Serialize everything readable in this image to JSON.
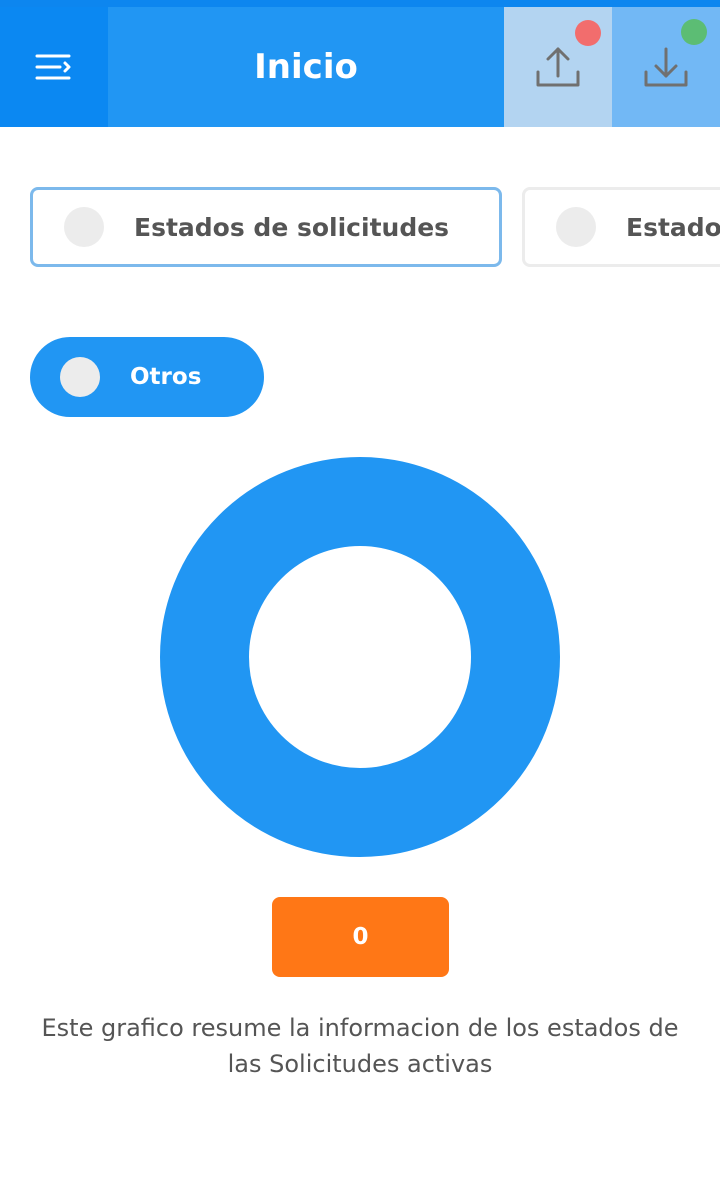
{
  "header": {
    "title": "Inicio",
    "menu_icon": "menu-icon",
    "upload_icon": "upload-icon",
    "download_icon": "download-icon",
    "upload_status_color": "#f26d6d",
    "download_status_color": "#5cbd74"
  },
  "tabs": [
    {
      "label": "Estados de solicitudes",
      "selected": true
    },
    {
      "label": "Estado",
      "selected": false
    }
  ],
  "filter": {
    "label": "Otros",
    "active": true
  },
  "chart_data": {
    "type": "pie",
    "variant": "donut",
    "slices": [
      {
        "label": "Otros",
        "value": 0,
        "color": "#2196f3"
      }
    ],
    "total": 0
  },
  "summary": {
    "count": "0",
    "caption": "Este grafico resume la informacion de los estados de las Solicitudes activas"
  },
  "colors": {
    "primary": "#2196f3",
    "accent": "#ff7716"
  }
}
